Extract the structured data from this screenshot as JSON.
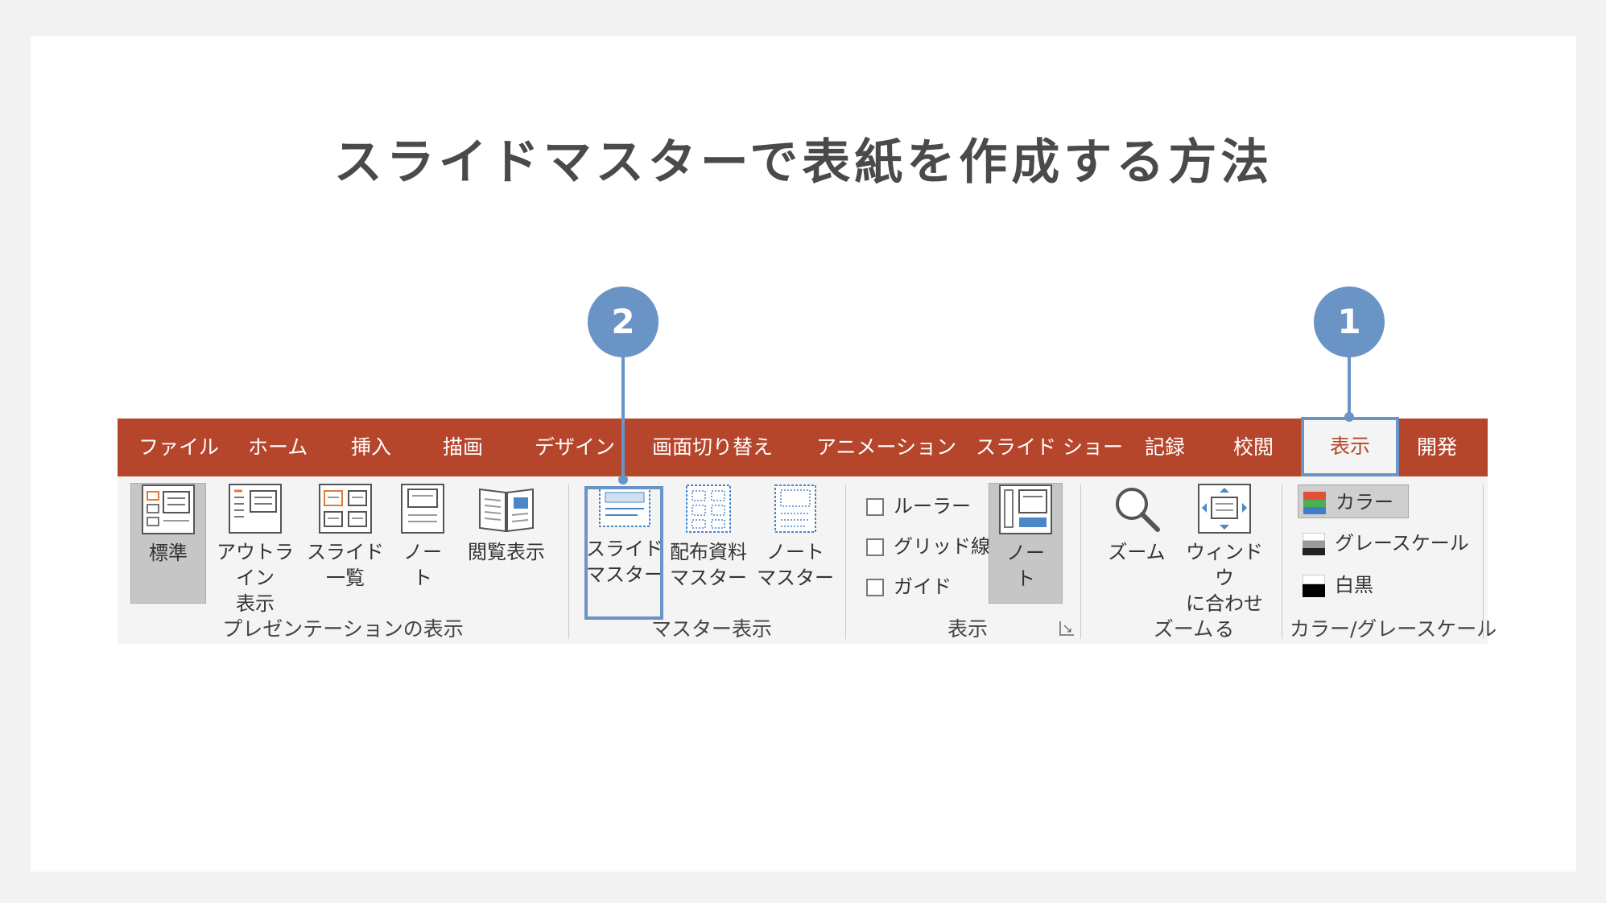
{
  "title": "スライドマスターで表紙を作成する方法",
  "colors": {
    "tab_bar": "#b5452b",
    "ribbon_bg": "#f4f4f4",
    "accent": "#6a93c6",
    "title_text": "#4a4a4a"
  },
  "callouts": [
    "1",
    "2"
  ],
  "tabs": [
    {
      "label": "ファイル"
    },
    {
      "label": "ホーム"
    },
    {
      "label": "挿入"
    },
    {
      "label": "描画"
    },
    {
      "label": "デザイン"
    },
    {
      "label": "画面切り替え"
    },
    {
      "label": "アニメーション"
    },
    {
      "label": "スライド ショー"
    },
    {
      "label": "記録"
    },
    {
      "label": "校閲"
    },
    {
      "label": "表示",
      "active": true
    },
    {
      "label": "開発"
    }
  ],
  "groups": {
    "presentation_view": {
      "label": "プレゼンテーションの表示",
      "buttons": [
        {
          "label": "標準",
          "icon": "normal-view-icon",
          "selected": true
        },
        {
          "label": "アウトライン\n表示",
          "icon": "outline-view-icon"
        },
        {
          "label": "スライド\n一覧",
          "icon": "slide-sorter-icon"
        },
        {
          "label": "ノー\nト",
          "icon": "notes-page-icon"
        },
        {
          "label": "閲覧表示",
          "icon": "reading-view-icon"
        }
      ]
    },
    "master_view": {
      "label": "マスター表示",
      "buttons": [
        {
          "label": "スライド\nマスター",
          "icon": "slide-master-icon"
        },
        {
          "label": "配布資料\nマスター",
          "icon": "handout-master-icon"
        },
        {
          "label": "ノート\nマスター",
          "icon": "notes-master-icon"
        }
      ]
    },
    "show": {
      "label": "表示",
      "checkboxes": [
        {
          "label": "ルーラー",
          "checked": false
        },
        {
          "label": "グリッド線",
          "checked": false
        },
        {
          "label": "ガイド",
          "checked": false
        }
      ],
      "notes_button": {
        "label": "ノー\nト",
        "icon": "notes-pane-icon",
        "selected": true
      }
    },
    "zoom": {
      "label": "ズーム",
      "buttons": [
        {
          "label": "ズーム",
          "icon": "magnifier-icon"
        },
        {
          "label": "ウィンドウ\nに合わせる",
          "icon": "fit-to-window-icon"
        }
      ]
    },
    "color_grayscale": {
      "label": "カラー/グレースケール",
      "options": [
        {
          "label": "カラー",
          "selected": true
        },
        {
          "label": "グレースケール"
        },
        {
          "label": "白黒"
        }
      ]
    }
  }
}
